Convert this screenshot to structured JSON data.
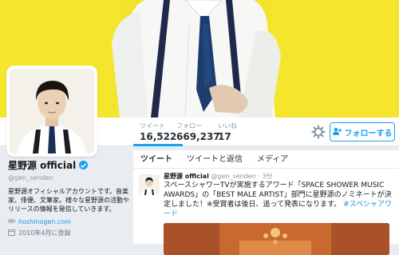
{
  "nav": {
    "tweets_label": "ツイート",
    "tweets_count": "16,522",
    "following_label": "フォロー",
    "following_count": "669,237",
    "likes_label": "いいね",
    "likes_count": "17",
    "follow_button": "フォローする"
  },
  "profile": {
    "name": "星野源 official",
    "handle": "@gen_senden",
    "bio": "星野源オフィシャルアカウントです。音楽家、俳優、文筆家。様々な星野源の活動やリリースの情報を発信していきます。",
    "website": "hoshinogen.com",
    "joined": "2010年4月に登録"
  },
  "tabs": [
    "ツイート",
    "ツイートと返信",
    "メディア"
  ],
  "tweet": {
    "name": "星野源 official",
    "handle": "@gen_senden",
    "time": "3分",
    "text": "スペースシャワーTVが実施するアワード「SPACE SHOWER MUSIC AWARDS」の「BEST MALE ARTIST」部門に星野源のノミネートが決定しました！※受賞者は後日、追って発表になります。",
    "hashtag": "#スペシャアワード"
  },
  "colors": {
    "banner": "#f5e52c",
    "accent": "#1da1f2",
    "link": "#1b95e0"
  },
  "icons": [
    "gear-icon",
    "follow-user-icon",
    "verified-icon",
    "link-icon",
    "calendar-icon"
  ]
}
